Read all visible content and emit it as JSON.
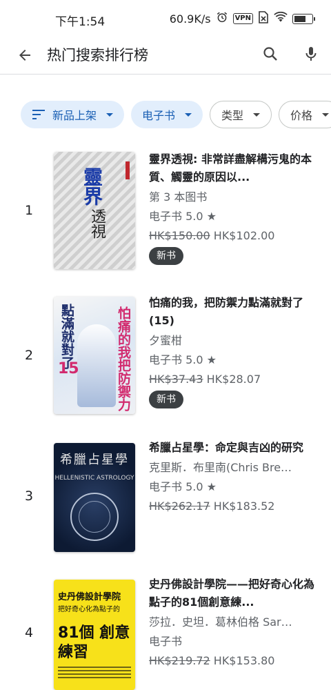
{
  "status_bar": {
    "time": "下午1:54",
    "speed": "60.9K/s",
    "vpn": "VPN",
    "battery_level": 0.68
  },
  "app_bar": {
    "title": "热门搜索排行榜"
  },
  "filters": [
    {
      "label": "新品上架",
      "selected": true
    },
    {
      "label": "电子书",
      "selected": true
    },
    {
      "label": "类型",
      "selected": false
    },
    {
      "label": "价格",
      "selected": false
    }
  ],
  "books": [
    {
      "rank": "1",
      "title": "靈界透視: 非常詳盡解構污鬼的本質、觸靈的原因以...",
      "meta": "第 3 本图书",
      "rating": "电子书 5.0 ★",
      "old_price": "HK$150.00",
      "new_price": "HK$102.00",
      "badge": "新书",
      "cover_text": "靈界",
      "cover_text2": "透視"
    },
    {
      "rank": "2",
      "title": "怕痛的我，把防禦力點滿就對了 (15)",
      "meta": "夕蜜柑",
      "rating": "电子书 5.0 ★",
      "old_price": "HK$37.43",
      "new_price": "HK$28.07",
      "badge": "新书",
      "cover_text": "點滿就對了",
      "cover_text2": "怕痛的我把防禦力",
      "cover_number": "15"
    },
    {
      "rank": "3",
      "title": "希臘占星學：命定與吉凶的研究",
      "meta": "克里斯．布里南(Chris Bre…",
      "rating": "电子书 5.0 ★",
      "old_price": "HK$262.17",
      "new_price": "HK$183.52",
      "badge": "",
      "cover_text": "希臘占星學",
      "cover_text2": "HELLENISTIC ASTROLOGY"
    },
    {
      "rank": "4",
      "title": "史丹佛設計學院——把好奇心化為點子的81個創意練...",
      "meta": "莎拉．史坦．葛林伯格 Sar…",
      "rating": "电子书",
      "old_price": "HK$219.72",
      "new_price": "HK$153.80",
      "badge": "",
      "cover_text": "史丹佛設計學院",
      "cover_text2": "把好奇心化為點子的",
      "cover_big": "81個 創意練習"
    }
  ]
}
